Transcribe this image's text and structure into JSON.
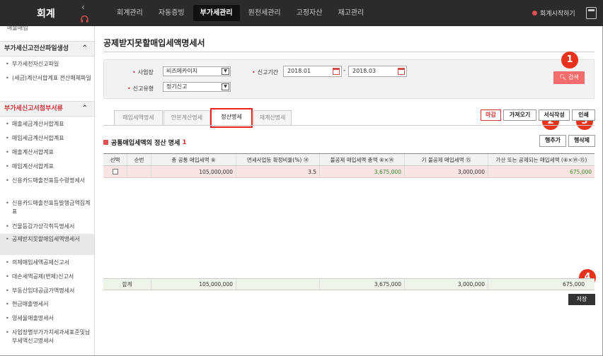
{
  "app": {
    "logo": "회계",
    "collapse": "‹",
    "top_right": "회계시작하기"
  },
  "nav": [
    "회계관리",
    "자동증빙",
    "부가세관리",
    "원천세관리",
    "고정자산",
    "재고관리"
  ],
  "sidebar": {
    "cut_top": "매출매입",
    "sec1": "부가세신고전산파일생성",
    "sec1_items": [
      "부가세전자신고파일",
      "(세금)계산서합계표 전산매체파일"
    ],
    "sec2": "부가세신고서첨부서류",
    "sec2_items": [
      "매출세금계산서합계표",
      "매입세금계산서합계표",
      "매출계산서합계표",
      "매입계산서합계표",
      "신용카드매출전표등수령명세서",
      "신용카드매출전표등발행금액집계표",
      "건물등감가상각취득명세서",
      "공제받지못할매입세액명세서",
      "의제매입세액공제신고서",
      "대손세액공제(변제)신고서",
      "부동산임대공급가액명세서",
      "현금매출명세서",
      "영세율매출명세서",
      "사업장별부가가치세과세표준및납부세액신고명세서"
    ]
  },
  "page": {
    "title": "공제받지못할매입세액명세서"
  },
  "search": {
    "biz_label": "사업장",
    "biz_value": "비즈메카이지",
    "period_label": "신고기간",
    "from": "2018.01",
    "dash": "-",
    "to": "2018.03",
    "type_label": "신고유형",
    "type_value": "정기신고",
    "search_btn": "검색"
  },
  "tabs": [
    "매입세액명세",
    "안분계산명세",
    "정산명세",
    "재계산명세"
  ],
  "right_buttons": [
    "마감",
    "가져오기",
    "서식작성",
    "인쇄"
  ],
  "row_buttons": [
    "행추가",
    "행삭제"
  ],
  "badges": [
    "1",
    "2",
    "3",
    "4"
  ],
  "section": {
    "title": "공통매입세액의 정산 명세",
    "count": "1"
  },
  "grid": {
    "headers": [
      "선택",
      "순번",
      "총 공통 매입세액 ⑧",
      "면세사업등 확정비율(%) ⑭",
      "불공제 매입세액 총액 ⑧×⑭",
      "기 불공제 매입세액 ⑮",
      "가산 또는 공제되는 매입세액 (⑧×⑭-⑮)"
    ],
    "row": [
      "",
      "",
      "105,000,000",
      "3.5",
      "3,675,000",
      "3,000,000",
      "675,000"
    ]
  },
  "total": [
    "합계",
    "105,000,000",
    "3,675,000",
    "3,000,000",
    "675,000"
  ],
  "save_btn": "저장"
}
